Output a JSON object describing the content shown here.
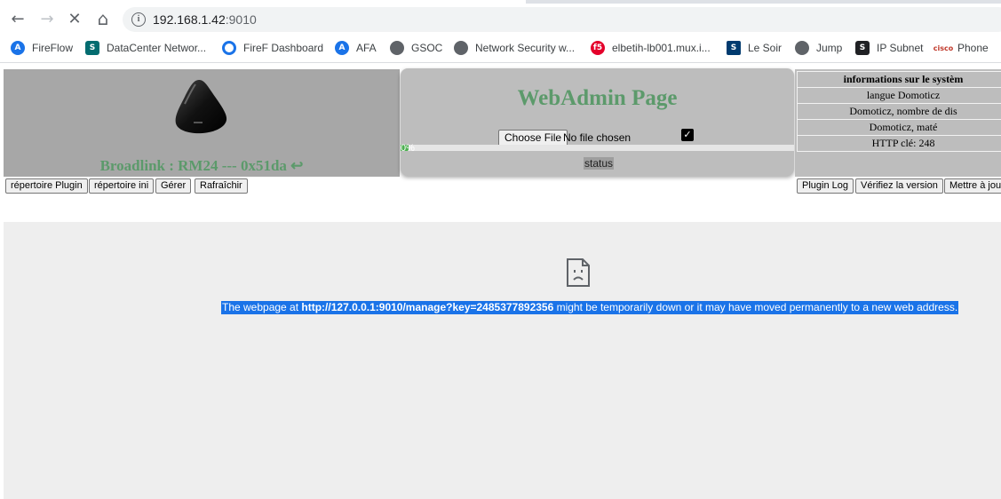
{
  "browser": {
    "url_host": "192.168.1.42",
    "url_port": ":9010",
    "nav": {
      "back_icon": "←",
      "forward_icon": "→",
      "stop_icon": "✕",
      "home_icon": "⌂"
    }
  },
  "bookmarks": [
    {
      "label": "FireFlow",
      "icon": "A"
    },
    {
      "label": "DataCenter Networ...",
      "icon": "S"
    },
    {
      "label": "FireF Dashboard",
      "icon": ""
    },
    {
      "label": "AFA",
      "icon": "A"
    },
    {
      "label": "GSOC",
      "icon": ""
    },
    {
      "label": "Network Security w...",
      "icon": ""
    },
    {
      "label": "elbetih-lb001.mux.i...",
      "icon": "f5"
    },
    {
      "label": "Le Soir",
      "icon": "S"
    },
    {
      "label": "Jump",
      "icon": ""
    },
    {
      "label": "IP Subnet",
      "icon": "S"
    },
    {
      "label": "Phone",
      "icon": "cisco"
    }
  ],
  "device": {
    "title": "Broadlink : RM24 --- 0x51da ↩"
  },
  "webadmin": {
    "title": "WebAdmin Page",
    "file_button": "Choose File",
    "file_status": "No file chosen",
    "checkbox_checked": true,
    "progress_text": "0%",
    "progress_value": 0.02,
    "status_label": "status"
  },
  "info_table": {
    "header": "informations sur le systèm",
    "rows": [
      "langue Domoticz",
      "Domoticz, nombre de dis",
      "Domoticz, maté",
      "HTTP clé: 248"
    ]
  },
  "left_buttons": [
    "répertoire Plugin",
    "répertoire ini",
    "Gérer",
    "Rafraîchir"
  ],
  "right_buttons": [
    "Plugin Log",
    "Vérifiez la version",
    "Mettre à jou"
  ],
  "error": {
    "prefix": "The webpage at ",
    "url": "http://127.0.0.1:9010/manage?key=2485377892356",
    "suffix": " might be temporarily down or it may have moved permanently to a new web address."
  },
  "colors": {
    "title_green": "#5c9a6b",
    "selection_blue": "#1a73e8",
    "progress_green": "#4caf50"
  }
}
